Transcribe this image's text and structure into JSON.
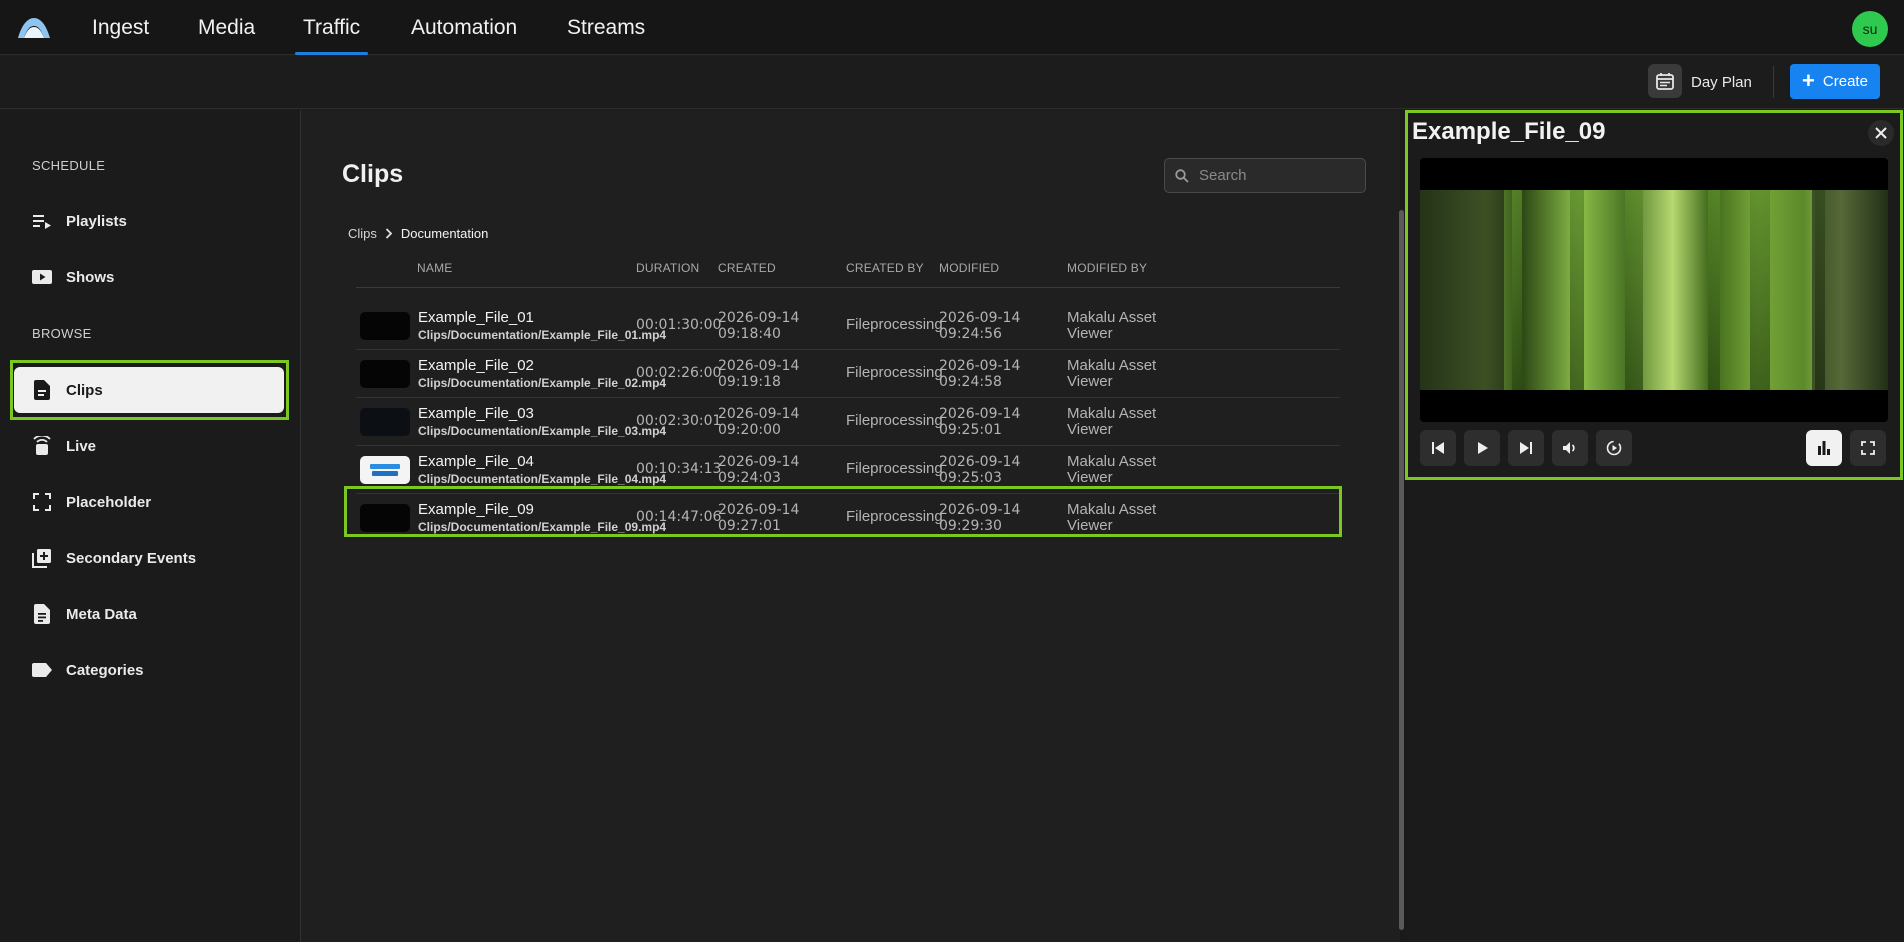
{
  "nav": {
    "tabs": [
      {
        "label": "Ingest"
      },
      {
        "label": "Media"
      },
      {
        "label": "Traffic"
      },
      {
        "label": "Automation"
      },
      {
        "label": "Streams"
      }
    ],
    "active_tab": "Traffic",
    "avatar_initials": "su"
  },
  "subbar": {
    "day_plan_label": "Day Plan",
    "create_label": "Create",
    "create_color": "#1683f0"
  },
  "sidebar": {
    "schedule_heading": "SCHEDULE",
    "browse_heading": "BROWSE",
    "schedule_items": [
      {
        "label": "Playlists",
        "icon": "playlist-icon"
      },
      {
        "label": "Shows",
        "icon": "video-icon"
      }
    ],
    "browse_items": [
      {
        "label": "Clips",
        "icon": "document-icon"
      },
      {
        "label": "Live",
        "icon": "live-broadcast-icon"
      },
      {
        "label": "Placeholder",
        "icon": "frame-corners-icon"
      },
      {
        "label": "Secondary Events",
        "icon": "add-layer-icon"
      },
      {
        "label": "Meta Data",
        "icon": "file-text-icon"
      },
      {
        "label": "Categories",
        "icon": "tag-icon"
      }
    ],
    "active_item": "Clips"
  },
  "main": {
    "title": "Clips",
    "search_placeholder": "Search",
    "breadcrumb": [
      "Clips",
      "Documentation"
    ],
    "columns": [
      "NAME",
      "DURATION",
      "CREATED",
      "CREATED BY",
      "MODIFIED",
      "MODIFIED BY"
    ],
    "rows": [
      {
        "name": "Example_File_01",
        "path": "Clips/Documentation/Example_File_01.mp4",
        "duration": "00:01:30:00",
        "created_date": "2026-09-14",
        "created_time": "09:18:40",
        "created_by": "Fileprocessing",
        "modified_date": "2026-09-14",
        "modified_time": "09:24:56",
        "modified_by_1": "Makalu Asset",
        "modified_by_2": "Viewer"
      },
      {
        "name": "Example_File_02",
        "path": "Clips/Documentation/Example_File_02.mp4",
        "duration": "00:02:26:00",
        "created_date": "2026-09-14",
        "created_time": "09:19:18",
        "created_by": "Fileprocessing",
        "modified_date": "2026-09-14",
        "modified_time": "09:24:58",
        "modified_by_1": "Makalu Asset",
        "modified_by_2": "Viewer"
      },
      {
        "name": "Example_File_03",
        "path": "Clips/Documentation/Example_File_03.mp4",
        "duration": "00:02:30:01",
        "created_date": "2026-09-14",
        "created_time": "09:20:00",
        "created_by": "Fileprocessing",
        "modified_date": "2026-09-14",
        "modified_time": "09:25:01",
        "modified_by_1": "Makalu Asset",
        "modified_by_2": "Viewer"
      },
      {
        "name": "Example_File_04",
        "path": "Clips/Documentation/Example_File_04.mp4",
        "duration": "00:10:34:13",
        "created_date": "2026-09-14",
        "created_time": "09:24:03",
        "created_by": "Fileprocessing",
        "modified_date": "2026-09-14",
        "modified_time": "09:25:03",
        "modified_by_1": "Makalu Asset",
        "modified_by_2": "Viewer"
      },
      {
        "name": "Example_File_09",
        "path": "Clips/Documentation/Example_File_09.mp4",
        "duration": "00:14:47:06",
        "created_date": "2026-09-14",
        "created_time": "09:27:01",
        "created_by": "Fileprocessing",
        "modified_date": "2026-09-14",
        "modified_time": "09:29:30",
        "modified_by_1": "Makalu Asset",
        "modified_by_2": "Viewer"
      }
    ],
    "selected_row": "Example_File_09"
  },
  "preview": {
    "title": "Example_File_09"
  },
  "colors": {
    "highlight": "#7cc823",
    "accent": "#1e7fe0",
    "avatar": "#2ec94e"
  }
}
